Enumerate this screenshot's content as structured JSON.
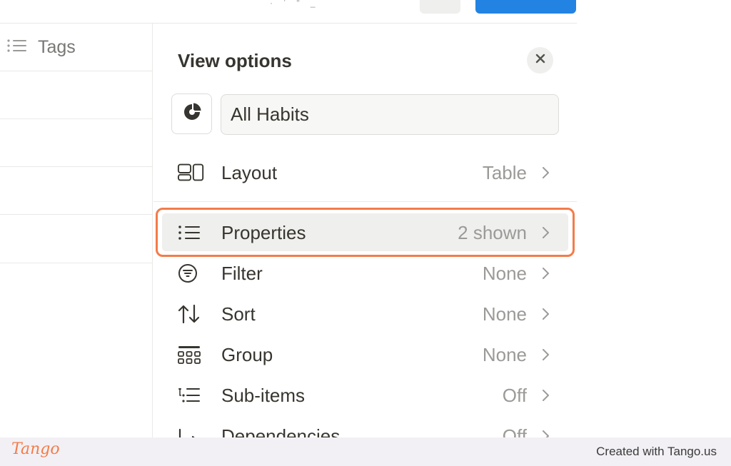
{
  "panel": {
    "title": "View options",
    "view_name": "All Habits"
  },
  "table": {
    "header_label": "Tags"
  },
  "top_toolbar": {
    "glyph_fragments": "· ʼ ʺ _"
  },
  "options": [
    {
      "label": "Layout",
      "value": "Table",
      "icon": "layout-icon"
    },
    {
      "label": "Properties",
      "value": "2 shown",
      "icon": "list-icon",
      "highlighted": true
    },
    {
      "label": "Filter",
      "value": "None",
      "icon": "filter-icon"
    },
    {
      "label": "Sort",
      "value": "None",
      "icon": "sort-icon"
    },
    {
      "label": "Group",
      "value": "None",
      "icon": "group-icon"
    },
    {
      "label": "Sub-items",
      "value": "Off",
      "icon": "sub-items-icon"
    },
    {
      "label": "Dependencies",
      "value": "Off",
      "icon": "dependencies-icon"
    }
  ],
  "footer": {
    "logo_text": "Tango",
    "created_text": "Created with Tango.us"
  },
  "colors": {
    "highlight": "#f37c4a",
    "primary_button": "#2383e2",
    "text": "#37352f",
    "muted_text": "#9b9a97"
  }
}
